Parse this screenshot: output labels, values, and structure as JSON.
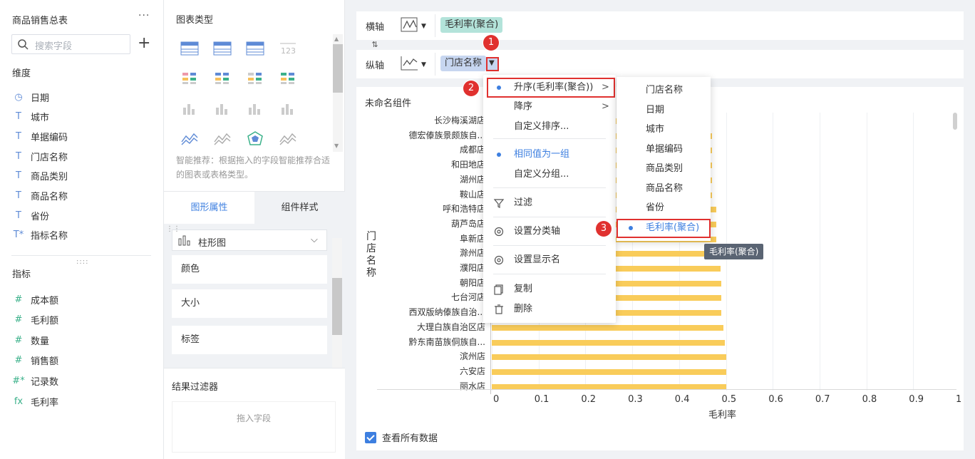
{
  "left_panel": {
    "title": "商品销售总表",
    "more": "···",
    "search_placeholder": "搜索字段",
    "plus": "+",
    "dimension_title": "维度",
    "dimensions": [
      {
        "icon": "clock-icon",
        "glyph": "◷",
        "label": "日期"
      },
      {
        "icon": "text-type-icon",
        "glyph": "T",
        "label": "城市"
      },
      {
        "icon": "text-type-icon",
        "glyph": "T",
        "label": "单据编码"
      },
      {
        "icon": "text-type-icon",
        "glyph": "T",
        "label": "门店名称"
      },
      {
        "icon": "text-type-icon",
        "glyph": "T",
        "label": "商品类别"
      },
      {
        "icon": "text-type-icon",
        "glyph": "T",
        "label": "商品名称"
      },
      {
        "icon": "text-type-icon",
        "glyph": "T",
        "label": "省份"
      },
      {
        "icon": "text-star-type-icon",
        "glyph": "T*",
        "label": "指标名称"
      }
    ],
    "divider_dots": "::::",
    "metric_title": "指标",
    "metrics": [
      {
        "icon": "hash-icon",
        "glyph": "#",
        "label": "成本额"
      },
      {
        "icon": "hash-icon",
        "glyph": "#",
        "label": "毛利额"
      },
      {
        "icon": "hash-icon",
        "glyph": "#",
        "label": "数量"
      },
      {
        "icon": "hash-icon",
        "glyph": "#",
        "label": "销售额"
      },
      {
        "icon": "hash-star-icon",
        "glyph": "#*",
        "label": "记录数"
      },
      {
        "icon": "formula-icon",
        "glyph": "fx",
        "label": "毛利率"
      }
    ]
  },
  "chart_type_panel": {
    "title": "图表类型",
    "hint": "智能推荐：根据拖入的字段智能推荐合适的图表或表格类型。",
    "tab_active": "图形属性",
    "tab_inactive": "组件样式",
    "graph_type": "柱形图",
    "props": [
      "颜色",
      "大小",
      "标签"
    ],
    "filter_title": "结果过滤器",
    "filter_placeholder": "拖入字段"
  },
  "axes": {
    "x_label": "横轴",
    "y_label": "纵轴",
    "x_field": "毛利率(聚合)",
    "y_field": "门店名称",
    "swap": "⇅"
  },
  "component": {
    "title": "未命名组件",
    "view_all": "查看所有数据"
  },
  "chart_data": {
    "type": "bar",
    "orientation": "horizontal",
    "ylabel": "门店名称",
    "xlabel": "毛利率",
    "xlim": [
      0,
      1
    ],
    "xticks": [
      "0",
      "0.1",
      "0.2",
      "0.3",
      "0.4",
      "0.5",
      "0.6",
      "0.7",
      "0.8",
      "0.9",
      "1"
    ],
    "categories": [
      "长沙梅溪湖店",
      "德宏傣族景颇族自...",
      "成都店",
      "和田地店",
      "湖州店",
      "鞍山店",
      "呼和浩特店",
      "葫芦岛店",
      "阜新店",
      "滁州店",
      "濮阳店",
      "朝阳店",
      "七台河店",
      "西双版纳傣族自治...",
      "大理白族自治区店",
      "黔东南苗族侗族自...",
      "滨州店",
      "六安店",
      "丽水店"
    ],
    "values": [
      0.46,
      0.47,
      0.47,
      0.47,
      0.47,
      0.47,
      0.48,
      0.48,
      0.48,
      0.48,
      0.488,
      0.49,
      0.49,
      0.49,
      0.495,
      0.497,
      0.5,
      0.5,
      0.5
    ],
    "grid": true,
    "bar_color": "#f9cc5a"
  },
  "context_menu": {
    "items": [
      {
        "label": "升序(毛利率(聚合))",
        "dot": true,
        "arrow": ">"
      },
      {
        "label": "降序",
        "dot": false,
        "arrow": ">"
      },
      {
        "label": "自定义排序...",
        "dot": false
      },
      {
        "label": "相同值为一组",
        "dot": true,
        "selected": true
      },
      {
        "label": "自定义分组...",
        "dot": false
      },
      {
        "label": "过滤",
        "icon": "filter-icon"
      },
      {
        "label": "设置分类轴",
        "icon": "gear-icon"
      },
      {
        "label": "设置显示名",
        "icon": "gear-icon"
      },
      {
        "label": "复制",
        "icon": "copy-icon"
      },
      {
        "label": "删除",
        "icon": "trash-icon"
      }
    ]
  },
  "submenu": {
    "items": [
      "门店名称",
      "日期",
      "城市",
      "单据编码",
      "商品类别",
      "商品名称",
      "省份",
      "毛利率(聚合)"
    ],
    "selected": "毛利率(聚合)"
  },
  "tooltip": "毛利率(聚合)",
  "badges": [
    "1",
    "2",
    "3"
  ],
  "colors": {
    "accent": "#3d7fe0",
    "highlight": "#e0312f",
    "bar": "#f9cc5a"
  }
}
